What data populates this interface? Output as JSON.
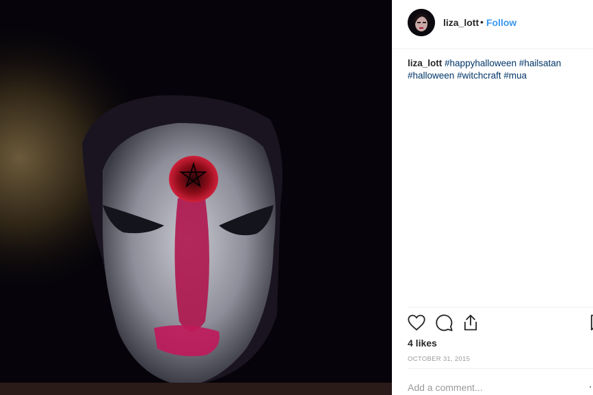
{
  "post": {
    "username": "liza_lott",
    "separator": "•",
    "follow_label": "Follow",
    "caption_user": "liza_lott",
    "hashtags": [
      "#happyhalloween",
      "#hailsatan",
      "#halloween",
      "#witchcraft",
      "#mua"
    ],
    "likes": "4 likes",
    "date": "OCTOBER 31, 2015",
    "comment_placeholder": "Add a comment...",
    "more_glyph": "⋅"
  },
  "icons": {
    "like": "heart-icon",
    "comment": "comment-bubble-icon",
    "share": "share-icon",
    "save": "bookmark-icon"
  },
  "colors": {
    "link": "#003569",
    "follow": "#3897f0",
    "text": "#262626",
    "muted": "#999999"
  }
}
